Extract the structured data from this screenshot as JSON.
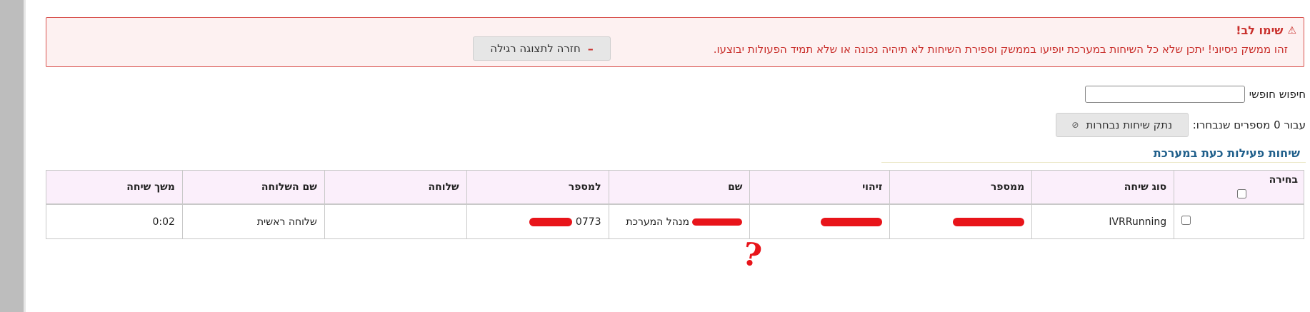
{
  "warning": {
    "title": "שימו לב!",
    "message": "זהו ממשק ניסיוני! יתכן שלא כל השיחות במערכת יופיעו בממשק וספירת השיחות לא תיהיה נכונה או שלא תמיד הפעולות יבוצעו.",
    "return_button_label": "חזרה לתצוגה רגילה"
  },
  "search": {
    "label": "חיפוש חופשי",
    "value": ""
  },
  "selection": {
    "label": "עבור 0 מספרים שנבחרו:",
    "disconnect_button_label": "נתק שיחות נבחרות"
  },
  "section_title": "שיחות פעילות כעת במערכת",
  "table": {
    "headers": {
      "select": "בחירה",
      "call_type": "סוג שיחה",
      "from_number": "ממספר",
      "caller_id": "זיהוי",
      "name": "שם",
      "to_number": "למספר",
      "extension": "שלוחה",
      "extension_name": "שם השלוחה",
      "duration": "משך שיחה"
    },
    "rows": [
      {
        "call_type": "IVRRunning",
        "from_number": "",
        "caller_id": "",
        "name": "מנהל המערכת",
        "to_number": "0773",
        "extension": "",
        "extension_name": "שלוחה ראשית",
        "duration": "0:02"
      }
    ]
  },
  "annotation": "?",
  "colors": {
    "warning_text": "#c9302c",
    "section_title": "#1f5f8b",
    "header_bg": "#fbeffb",
    "redaction": "#e8141a"
  }
}
